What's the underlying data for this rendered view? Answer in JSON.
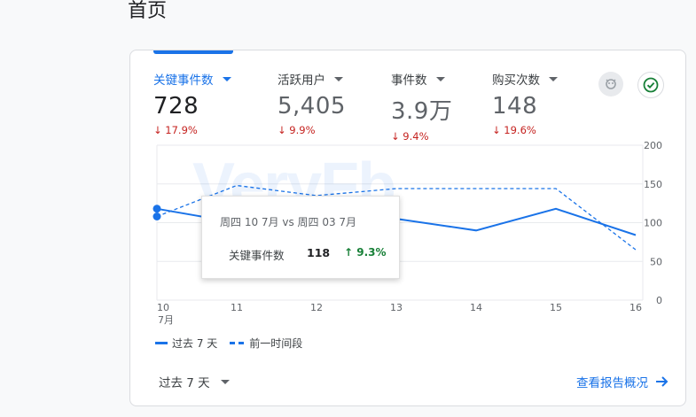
{
  "page_title": "首页",
  "metrics": [
    {
      "label": "关键事件数",
      "value": "728",
      "change": "↓ 17.9%",
      "active": true
    },
    {
      "label": "活跃用户",
      "value": "5,405",
      "change": "↓ 9.9%",
      "active": false
    },
    {
      "label": "事件数",
      "value": "3.9万",
      "change": "↓ 9.4%",
      "active": false
    },
    {
      "label": "购买次数",
      "value": "148",
      "change": "↓ 19.6%",
      "active": false
    }
  ],
  "icons": {
    "insights": "insights-icon",
    "check": "check-circle-icon"
  },
  "colors": {
    "primary": "#1a73e8",
    "negative": "#c5221f",
    "positive": "#188038"
  },
  "watermark": "VeryFb",
  "tooltip": {
    "title": "周四 10 7月 vs 周四 03 7月",
    "metric_label": "关键事件数",
    "metric_value": "118",
    "change": "↑ 9.3%"
  },
  "legend": {
    "current": "过去 7 天",
    "previous": "前一时间段"
  },
  "date_range": "过去 7 天",
  "report_link": "查看报告概况",
  "chart_data": {
    "type": "line",
    "categories": [
      "10",
      "11",
      "12",
      "13",
      "14",
      "15",
      "16"
    ],
    "first_category_sublabel": "7月",
    "series": [
      {
        "name": "过去 7 天",
        "values": [
          118,
          100,
          110,
          105,
          90,
          118,
          84
        ],
        "style": "solid"
      },
      {
        "name": "前一时间段",
        "values": [
          108,
          148,
          135,
          144,
          144,
          144,
          65
        ],
        "style": "dashed"
      }
    ],
    "y_ticks": [
      "0",
      "50",
      "100",
      "150",
      "200"
    ],
    "ylim": [
      0,
      200
    ],
    "grid": true
  }
}
